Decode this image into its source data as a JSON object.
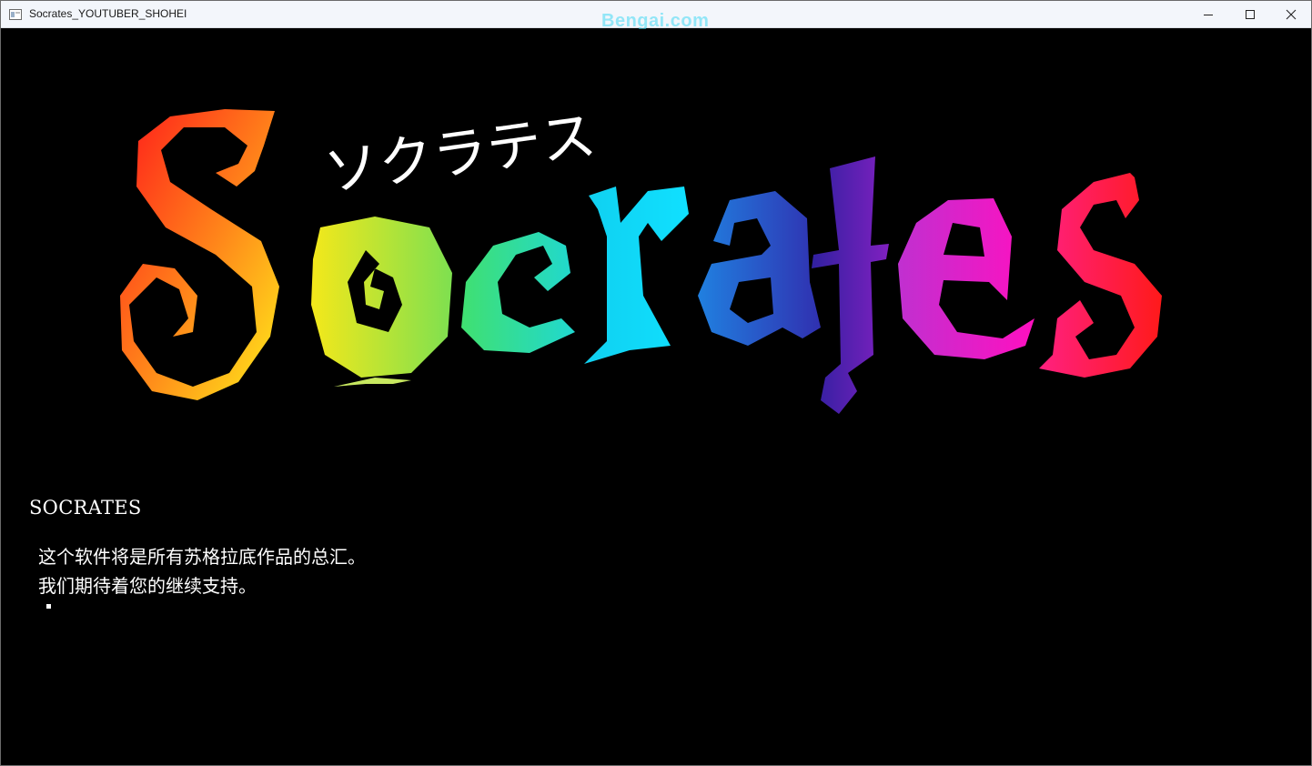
{
  "window": {
    "title": "Socrates_YOUTUBER_SHOHEI",
    "watermark": "Bengai.com",
    "controls": {
      "minimize_icon": "minimize-icon",
      "maximize_icon": "maximize-icon",
      "close_icon": "close-icon"
    }
  },
  "logo": {
    "main_text": "Socrates",
    "katakana": "ソクラテス",
    "letter_colors": [
      "#ff2a1a",
      "#f7e81a",
      "#40e070",
      "#10d8f0",
      "#3040c0",
      "#a020c0",
      "#ff20c8",
      "#ff2a50"
    ]
  },
  "dialog": {
    "title": "SOCRATES",
    "lines": [
      "这个软件将是所有苏格拉底作品的总汇。",
      "我们期待着您的继续支持。"
    ]
  }
}
